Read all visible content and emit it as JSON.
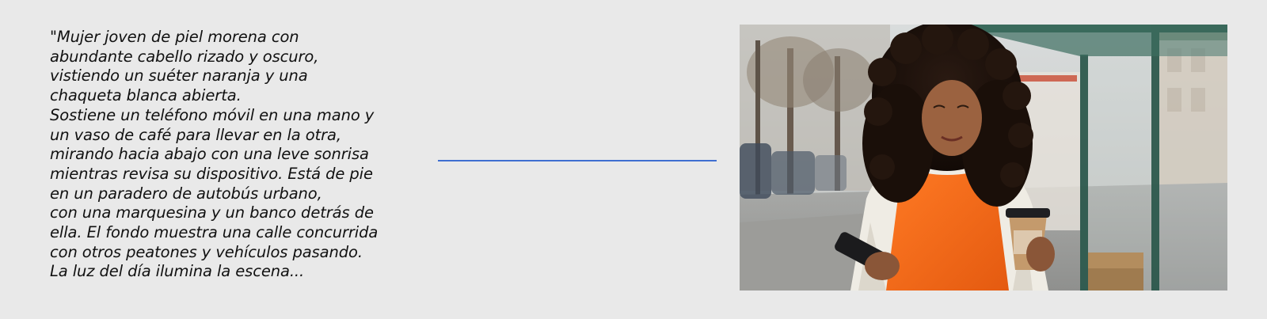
{
  "caption": {
    "lines": [
      "\"Mujer joven de piel morena con",
      "abundante cabello rizado y oscuro,",
      "vistiendo un suéter naranja y una",
      "chaqueta blanca abierta.",
      "Sostiene un teléfono móvil en una mano y",
      "un vaso de café para llevar en la otra,",
      "mirando hacia abajo con una leve sonrisa",
      "mientras revisa su dispositivo. Está de pie",
      "en un paradero de autobús urbano,",
      "con una marquesina y un banco detrás de",
      "ella. El fondo muestra una calle concurrida",
      "con otros peatones y vehículos pasando.",
      "La luz del día ilumina la escena..."
    ]
  },
  "colors": {
    "background": "#e9e9e9",
    "connector": "#3f6fd1",
    "sweater": "#f26a1b",
    "jacket": "#efece4",
    "shelter_frame": "#2e5a4e"
  },
  "photo": {
    "subject": "woman-at-bus-stop-photo"
  }
}
